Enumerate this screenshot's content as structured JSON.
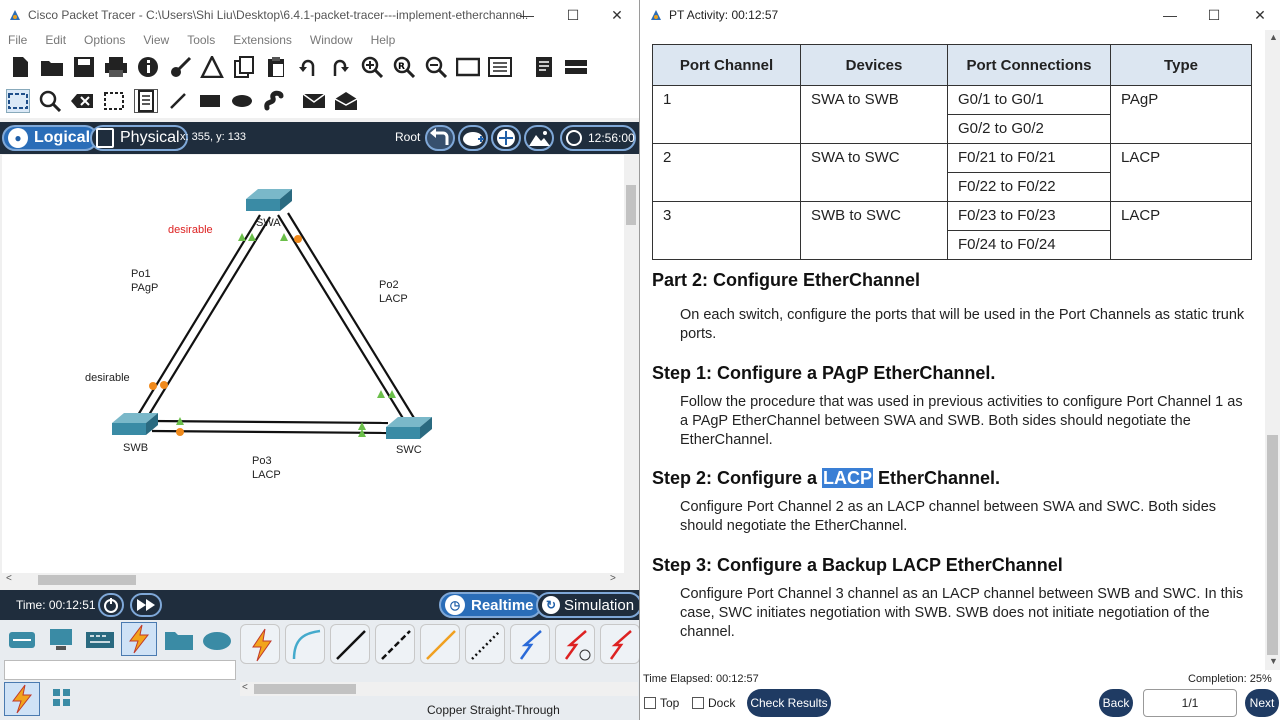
{
  "left_window": {
    "title": "Cisco Packet Tracer - C:\\Users\\Shi Liu\\Desktop\\6.4.1-packet-tracer---implement-etherchannel....",
    "menu": [
      "File",
      "Edit",
      "Options",
      "View",
      "Tools",
      "Extensions",
      "Window",
      "Help"
    ],
    "view_tabs": {
      "logical": "Logical",
      "physical": "Physical"
    },
    "coords": "x: 355, y: 133",
    "root": "Root",
    "clock": "12:56:00",
    "labels": {
      "swa": "SWA",
      "swb": "SWB",
      "swc": "SWC",
      "desirable_top": "desirable",
      "desirable_left": "desirable",
      "po1": "Po1",
      "po1_type": "PAgP",
      "po2": "Po2",
      "po2_type": "LACP",
      "po3": "Po3",
      "po3_type": "LACP"
    },
    "time": "Time: 00:12:51",
    "realtime": "Realtime",
    "simulation": "Simulation",
    "connection_label": "Copper Straight-Through"
  },
  "right_window": {
    "title": "PT Activity: 00:12:57",
    "table": {
      "headers": [
        "Port Channel",
        "Devices",
        "Port Connections",
        "Type"
      ],
      "rows": [
        {
          "channel": "1",
          "devices": "SWA to SWB",
          "conn1": "G0/1 to G0/1",
          "conn2": "G0/2 to G0/2",
          "type": "PAgP"
        },
        {
          "channel": "2",
          "devices": "SWA to SWC",
          "conn1": "F0/21 to F0/21",
          "conn2": "F0/22 to F0/22",
          "type": "LACP"
        },
        {
          "channel": "3",
          "devices": "SWB to SWC",
          "conn1": "F0/23 to F0/23",
          "conn2": "F0/24 to F0/24",
          "type": "LACP"
        }
      ]
    },
    "part2_title": "Part 2: Configure EtherChannel",
    "part2_text": "On each switch, configure the ports that will be used in the Port Channels as static trunk ports.",
    "step1_title": "Step 1: Configure a PAgP EtherChannel.",
    "step1_text": "Follow the procedure that was used in previous activities to configure Port Channel 1 as a PAgP EtherChannel between SWA and SWB. Both sides should negotiate the EtherChannel.",
    "step2_prefix": "Step 2: Configure a ",
    "step2_highlight": "LACP",
    "step2_suffix": " EtherChannel.",
    "step2_text": "Configure Port Channel 2 as an LACP channel between SWA and SWC. Both sides should negotiate the EtherChannel.",
    "step3_title": "Step 3: Configure a Backup LACP EtherChannel",
    "step3_text": "Configure Port Channel 3 channel as an LACP channel between SWB and SWC. In this case, SWC initiates negotiation with SWB. SWB does not initiate negotiation of the channel.",
    "time_elapsed": "Time Elapsed: 00:12:57",
    "completion": "Completion: 25%",
    "top": "Top",
    "dock": "Dock",
    "check_results": "Check Results",
    "back": "Back",
    "page": "1/1",
    "next": "Next"
  }
}
